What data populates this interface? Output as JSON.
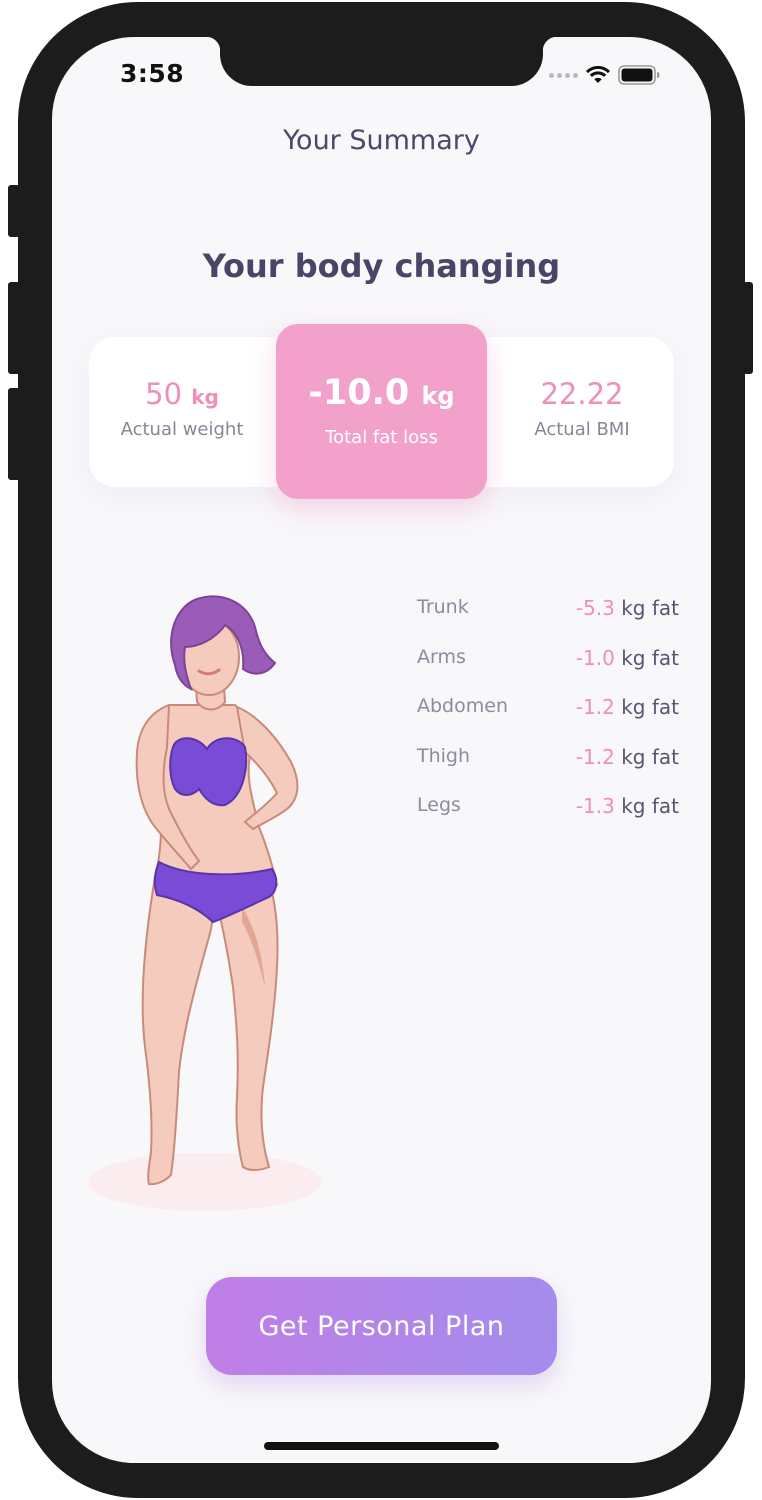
{
  "status_bar": {
    "time": "3:58"
  },
  "nav": {
    "title": "Your Summary"
  },
  "section": {
    "title": "Your body changing"
  },
  "stats": {
    "actual_weight": {
      "value": "50",
      "unit": "kg",
      "label": "Actual weight"
    },
    "total_fat_loss": {
      "value": "-10.0",
      "unit": "kg",
      "label": "Total fat loss"
    },
    "actual_bmi": {
      "value": "22.22",
      "label": "Actual BMI"
    }
  },
  "fat_loss": [
    {
      "part": "Trunk",
      "value": "-5.3",
      "unit": "kg fat"
    },
    {
      "part": "Arms",
      "value": "-1.0",
      "unit": "kg fat"
    },
    {
      "part": "Abdomen",
      "value": "-1.2",
      "unit": "kg fat"
    },
    {
      "part": "Thigh",
      "value": "-1.2",
      "unit": "kg fat"
    },
    {
      "part": "Legs",
      "value": "-1.3",
      "unit": "kg fat"
    }
  ],
  "cta": {
    "label": "Get Personal Plan"
  },
  "icons": {
    "signal": "cellular-signal-icon",
    "wifi": "wifi-icon",
    "battery": "battery-icon",
    "figure": "body-figure-illustration"
  },
  "colors": {
    "accent_pink": "#ee8fb9",
    "highlight_pink": "#f2a2ca",
    "cta_start": "#c07ee6",
    "cta_end": "#a48ced",
    "title_text": "#4b4466"
  }
}
